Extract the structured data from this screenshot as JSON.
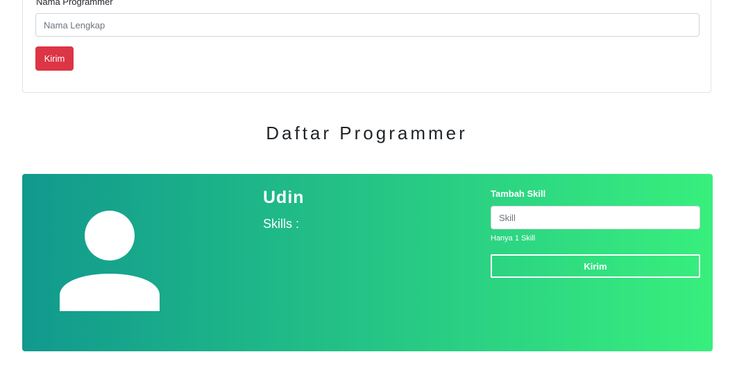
{
  "form": {
    "label": "Nama Programmer",
    "input_value": "",
    "input_placeholder": "Nama Lengkap",
    "submit_label": "Kirim"
  },
  "list": {
    "title": "Daftar Programmer"
  },
  "programmers": [
    {
      "name": "Udin",
      "skills_label": "Skills :",
      "add_skill_label": "Tambah Skill",
      "skill_input_value": "",
      "skill_input_placeholder": "Skill",
      "helper_text": "Hanya 1 Skill",
      "submit_label": "Kirim",
      "avatar_icon": "user-icon"
    }
  ],
  "colors": {
    "danger": "#dc3545",
    "gradient_start": "#11998e",
    "gradient_end": "#38ef7d"
  }
}
